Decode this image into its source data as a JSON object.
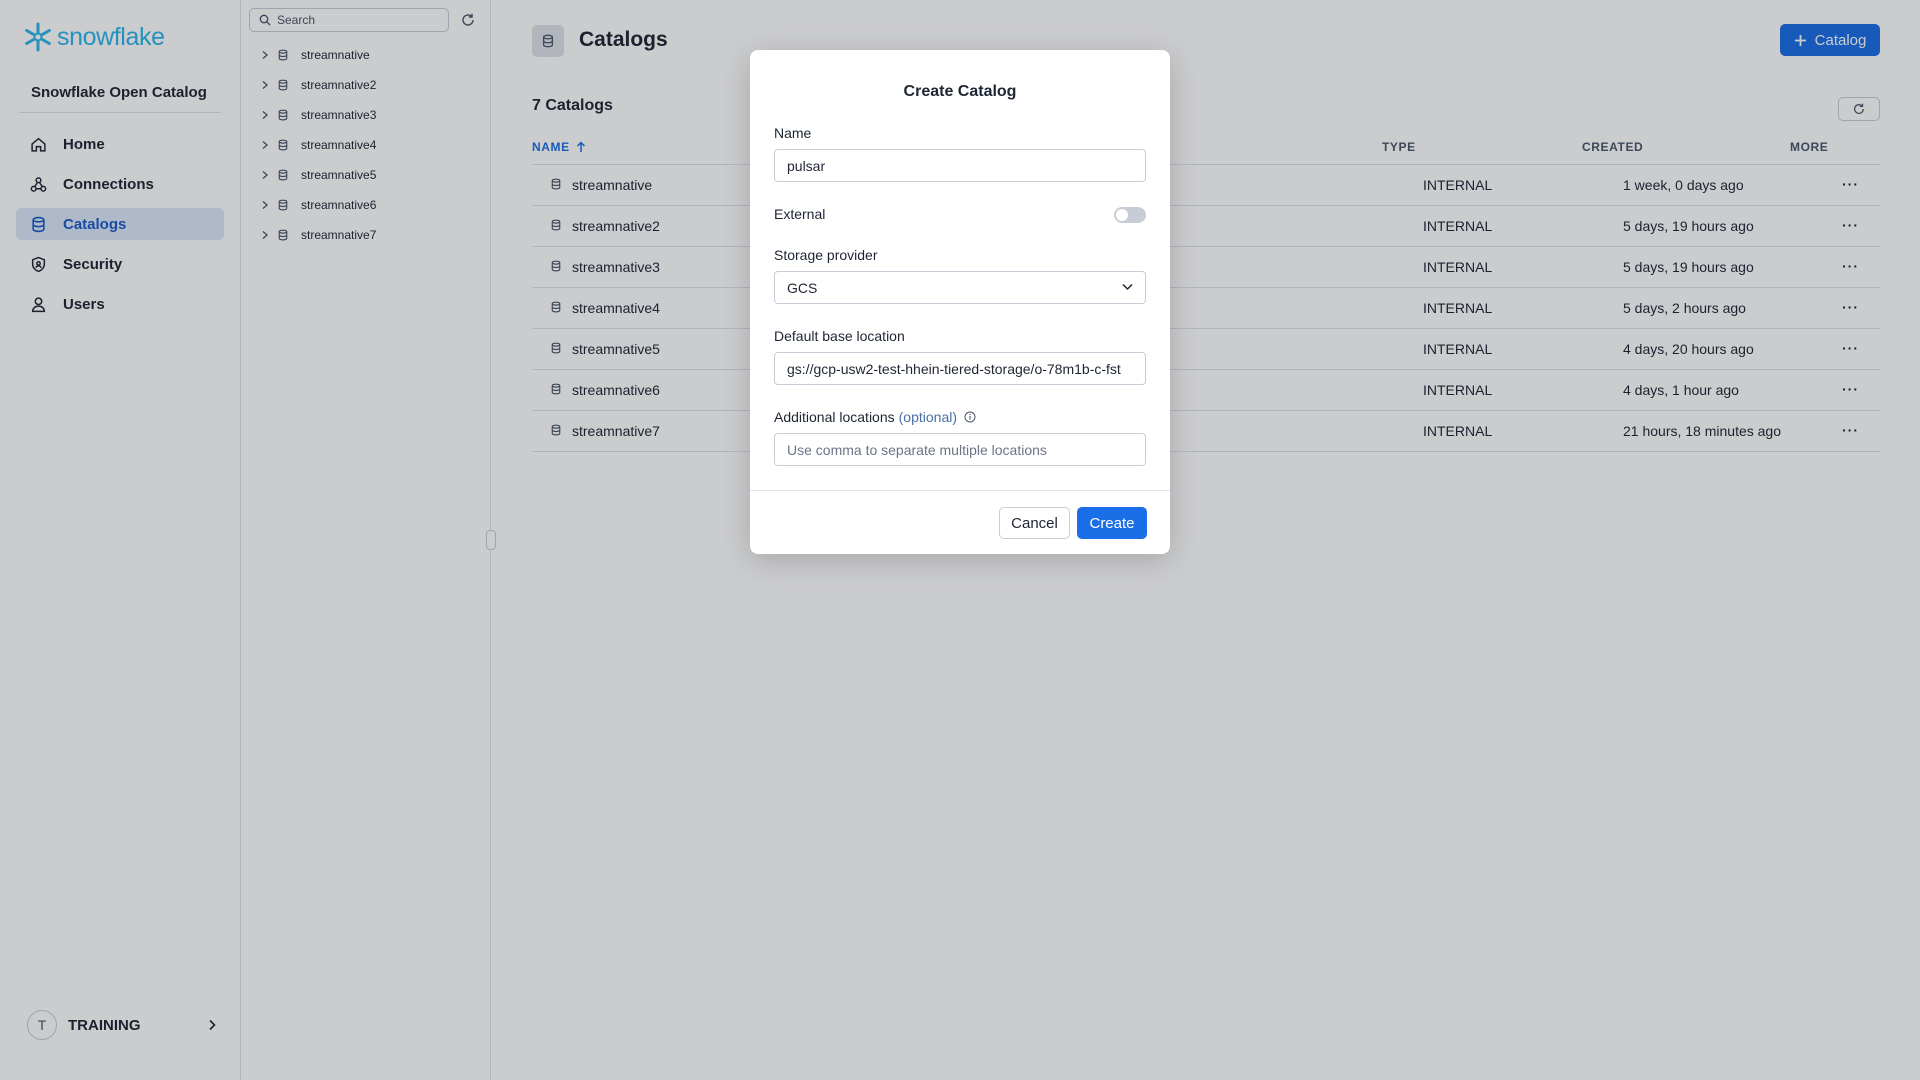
{
  "brand": {
    "logo_text": "snowflake",
    "accent": "#29b5e8"
  },
  "sidebar": {
    "org_title": "Snowflake Open Catalog",
    "items": [
      {
        "label": "Home",
        "icon": "home-icon",
        "active": false
      },
      {
        "label": "Connections",
        "icon": "connections-icon",
        "active": false
      },
      {
        "label": "Catalogs",
        "icon": "database-icon",
        "active": true
      },
      {
        "label": "Security",
        "icon": "shield-icon",
        "active": false
      },
      {
        "label": "Users",
        "icon": "user-icon",
        "active": false
      }
    ],
    "user": {
      "initial": "T",
      "name": "TRAINING"
    }
  },
  "tree": {
    "search_placeholder": "Search",
    "items": [
      "streamnative",
      "streamnative2",
      "streamnative3",
      "streamnative4",
      "streamnative5",
      "streamnative6",
      "streamnative7"
    ]
  },
  "main": {
    "title": "Catalogs",
    "add_button": "Catalog",
    "count_label": "7 Catalogs",
    "columns": {
      "name": "NAME",
      "type": "TYPE",
      "created": "CREATED",
      "more": "MORE"
    },
    "rows": [
      {
        "name": "streamnative",
        "type": "INTERNAL",
        "created": "1 week, 0 days ago"
      },
      {
        "name": "streamnative2",
        "type": "INTERNAL",
        "created": "5 days, 19 hours ago"
      },
      {
        "name": "streamnative3",
        "type": "INTERNAL",
        "created": "5 days, 19 hours ago"
      },
      {
        "name": "streamnative4",
        "type": "INTERNAL",
        "created": "5 days, 2 hours ago"
      },
      {
        "name": "streamnative5",
        "type": "INTERNAL",
        "created": "4 days, 20 hours ago"
      },
      {
        "name": "streamnative6",
        "type": "INTERNAL",
        "created": "4 days, 1 hour ago"
      },
      {
        "name": "streamnative7",
        "type": "INTERNAL",
        "created": "21 hours, 18 minutes ago"
      }
    ],
    "more_glyph": "···"
  },
  "modal": {
    "title": "Create Catalog",
    "name_label": "Name",
    "name_value": "pulsar",
    "external_label": "External",
    "external_on": false,
    "storage_label": "Storage provider",
    "storage_value": "GCS",
    "base_label": "Default base location",
    "base_value": "gs://gcp-usw2-test-hhein-tiered-storage/o-78m1b-c-fst",
    "additional_label": "Additional locations",
    "additional_optional": "(optional)",
    "additional_placeholder": "Use comma to separate multiple locations",
    "cancel": "Cancel",
    "create": "Create"
  },
  "colors": {
    "primary": "#1a6ee6",
    "nav_active_bg": "#dbe7f9"
  }
}
